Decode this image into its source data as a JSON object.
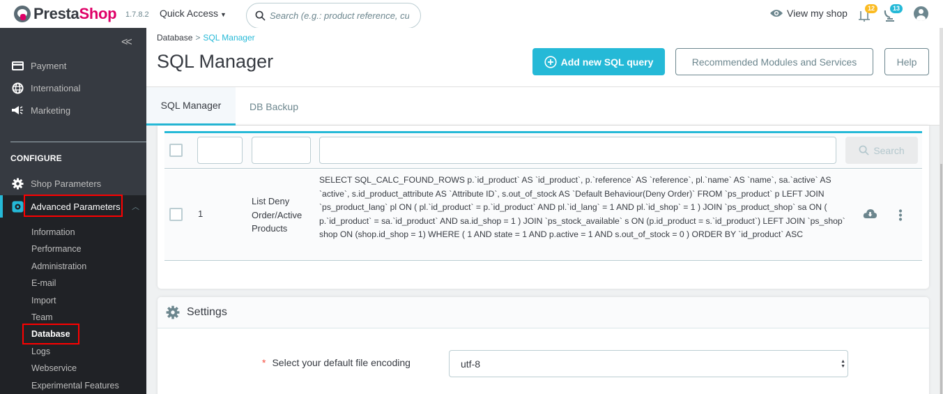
{
  "header": {
    "brand_part1": "Presta",
    "brand_part2": "Shop",
    "version": "1.7.8.2",
    "quick_access": "Quick Access",
    "search_placeholder": "Search (e.g.: product reference, custon",
    "view_shop": "View my shop",
    "notifications": [
      {
        "icon": "bell-icon",
        "count": "12",
        "color": "#fbbb22"
      },
      {
        "icon": "customer-service-icon",
        "count": "13",
        "color": "#25b9d7"
      }
    ]
  },
  "sidebar": {
    "collapse_label": "«",
    "items": [
      {
        "label": "Payment",
        "icon": "credit-card-icon"
      },
      {
        "label": "International",
        "icon": "globe-icon"
      },
      {
        "label": "Marketing",
        "icon": "megaphone-icon"
      }
    ],
    "section": "CONFIGURE",
    "configure_items": [
      {
        "label": "Shop Parameters",
        "icon": "gear-icon"
      },
      {
        "label": "Advanced Parameters",
        "icon": "advanced-gear-icon"
      }
    ],
    "submenu": [
      "Information",
      "Performance",
      "Administration",
      "E-mail",
      "Import",
      "Team",
      "Database",
      "Logs",
      "Webservice",
      "Experimental Features"
    ],
    "active_submenu": "Database"
  },
  "breadcrumb": {
    "parent": "Database",
    "separator": ">",
    "current": "SQL Manager"
  },
  "page": {
    "title": "SQL Manager",
    "add_button": "Add new SQL query",
    "modules_button": "Recommended Modules and Services",
    "help_button": "Help"
  },
  "tabs": [
    {
      "label": "SQL Manager",
      "active": true
    },
    {
      "label": "DB Backup",
      "active": false
    }
  ],
  "table": {
    "filters": {
      "id": "",
      "name": "",
      "sql": ""
    },
    "search_button": "Search",
    "rows": [
      {
        "id": "1",
        "name": "List Deny Order/Active Products",
        "sql": "SELECT SQL_CALC_FOUND_ROWS p.`id_product` AS `id_product`, p.`reference` AS `reference`, pl.`name` AS `name`, sa.`active` AS `active`, s.id_product_attribute AS `Attribute ID`, s.out_of_stock AS `Default Behaviour(Deny Order)` FROM `ps_product` p LEFT JOIN `ps_product_lang` pl ON ( pl.`id_product` = p.`id_product` AND pl.`id_lang` = 1 AND pl.`id_shop` = 1 ) JOIN `ps_product_shop` sa ON ( p.`id_product` = sa.`id_product` AND sa.id_shop = 1 ) JOIN `ps_stock_available` s ON (p.id_product = s.`id_product`) LEFT JOIN `ps_shop` shop ON (shop.id_shop = 1) WHERE ( 1 AND state = 1 AND p.active = 1 AND s.out_of_stock = 0 ) ORDER BY `id_product` ASC"
      }
    ]
  },
  "settings": {
    "title": "Settings",
    "required_mark": "*",
    "encoding_label": "Select your default file encoding",
    "encoding_value": "utf-8"
  },
  "colors": {
    "accent": "#25b9d7",
    "brand_pink": "#df0067",
    "sidebar_bg": "#363a41",
    "highlight_box": "#ff0000"
  }
}
